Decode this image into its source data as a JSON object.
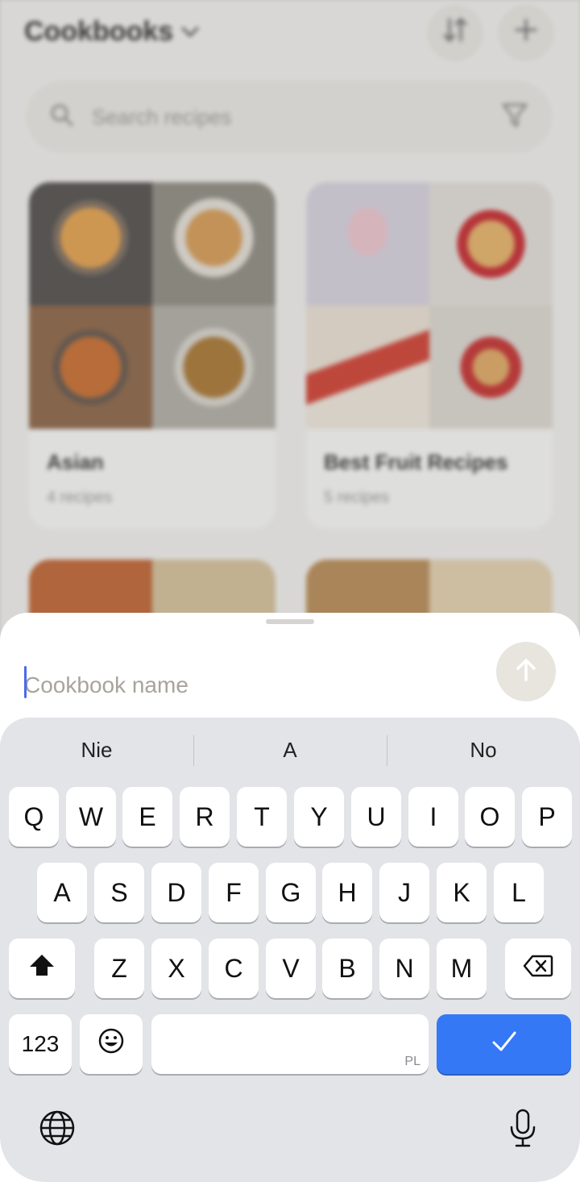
{
  "header": {
    "title": "Cookbooks"
  },
  "search": {
    "placeholder": "Search recipes"
  },
  "cookbooks": [
    {
      "name": "Asian",
      "count": "4 recipes"
    },
    {
      "name": "Best Fruit Recipes",
      "count": "5 recipes"
    }
  ],
  "sheet": {
    "input_placeholder": "Cookbook name",
    "input_value": ""
  },
  "keyboard": {
    "suggestions": [
      "Nie",
      "A",
      "No"
    ],
    "row1": [
      "Q",
      "W",
      "E",
      "R",
      "T",
      "Y",
      "U",
      "I",
      "O",
      "P"
    ],
    "row2": [
      "A",
      "S",
      "D",
      "F",
      "G",
      "H",
      "J",
      "K",
      "L"
    ],
    "row3": [
      "Z",
      "X",
      "C",
      "V",
      "B",
      "N",
      "M"
    ],
    "numbers_label": "123",
    "language_tag": "PL"
  },
  "colors": {
    "accent": "#3478f6",
    "caret": "#4b6bea",
    "keyboard_bg": "#e3e4e8"
  },
  "icons": [
    "chevron-down-icon",
    "sort-icon",
    "plus-icon",
    "search-icon",
    "filter-icon",
    "arrow-up-icon",
    "shift-icon",
    "backspace-icon",
    "emoji-icon",
    "checkmark-icon",
    "globe-icon",
    "microphone-icon"
  ]
}
